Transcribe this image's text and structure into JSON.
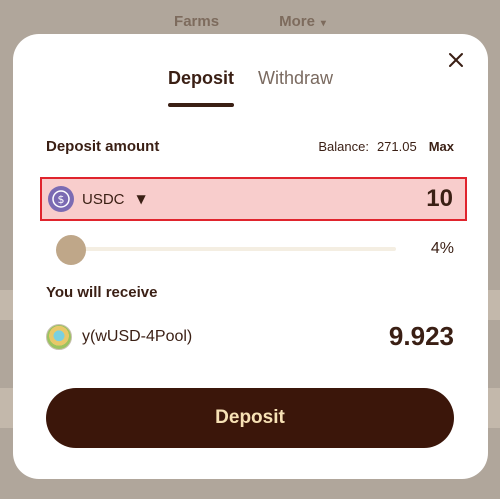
{
  "background_nav": {
    "farms_label": "Farms",
    "more_label": "More"
  },
  "modal": {
    "tabs": [
      {
        "label": "Deposit",
        "active": true
      },
      {
        "label": "Withdraw",
        "active": false
      }
    ],
    "deposit_amount_label": "Deposit amount",
    "balance_label": "Balance:",
    "balance_value": "271.05",
    "max_label": "Max",
    "token": {
      "name": "USDC",
      "icon": "usdc-icon"
    },
    "amount_value": "10",
    "slider_percent_label": "4%",
    "slider_fraction": 0.04,
    "receive_label": "You will receive",
    "receive_token": {
      "name": "y(wUSD-4Pool)",
      "icon": "pool-token-icon"
    },
    "receive_amount": "9.923",
    "deposit_button_label": "Deposit"
  },
  "colors": {
    "primary_dark": "#3b160a",
    "button_text": "#f7e1b5",
    "highlight_border": "#e0242d",
    "highlight_fill": "#f8cdcc"
  }
}
